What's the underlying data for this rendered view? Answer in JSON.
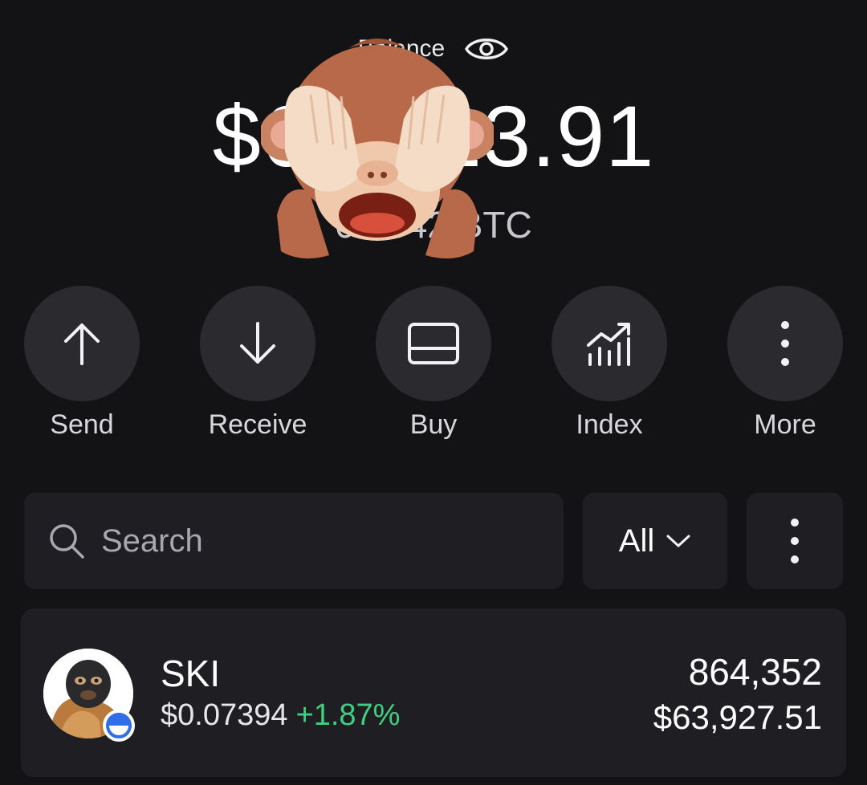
{
  "balance": {
    "label": "Balance",
    "amount": "$64,423.91",
    "btc": "0.6842 BTC",
    "visibility_icon": "eye-icon",
    "overlay_icon": "see-no-evil-monkey-emoji"
  },
  "actions": [
    {
      "label": "Send",
      "icon": "arrow-up-icon"
    },
    {
      "label": "Receive",
      "icon": "arrow-down-icon"
    },
    {
      "label": "Buy",
      "icon": "card-icon"
    },
    {
      "label": "Index",
      "icon": "chart-icon"
    },
    {
      "label": "More",
      "icon": "more-vertical-icon"
    }
  ],
  "search": {
    "placeholder": "Search",
    "icon": "search-icon"
  },
  "filter": {
    "label": "All",
    "icon": "chevron-down-icon"
  },
  "tokens": [
    {
      "symbol": "SKI",
      "price": "$0.07394",
      "change": "+1.87%",
      "quantity": "864,352",
      "value": "$63,927.51",
      "chain_icon": "chain-badge-icon"
    }
  ],
  "colors": {
    "background": "#131316",
    "card": "#1f1f23",
    "button": "#2b2b2f",
    "positive": "#3fcf7f"
  }
}
